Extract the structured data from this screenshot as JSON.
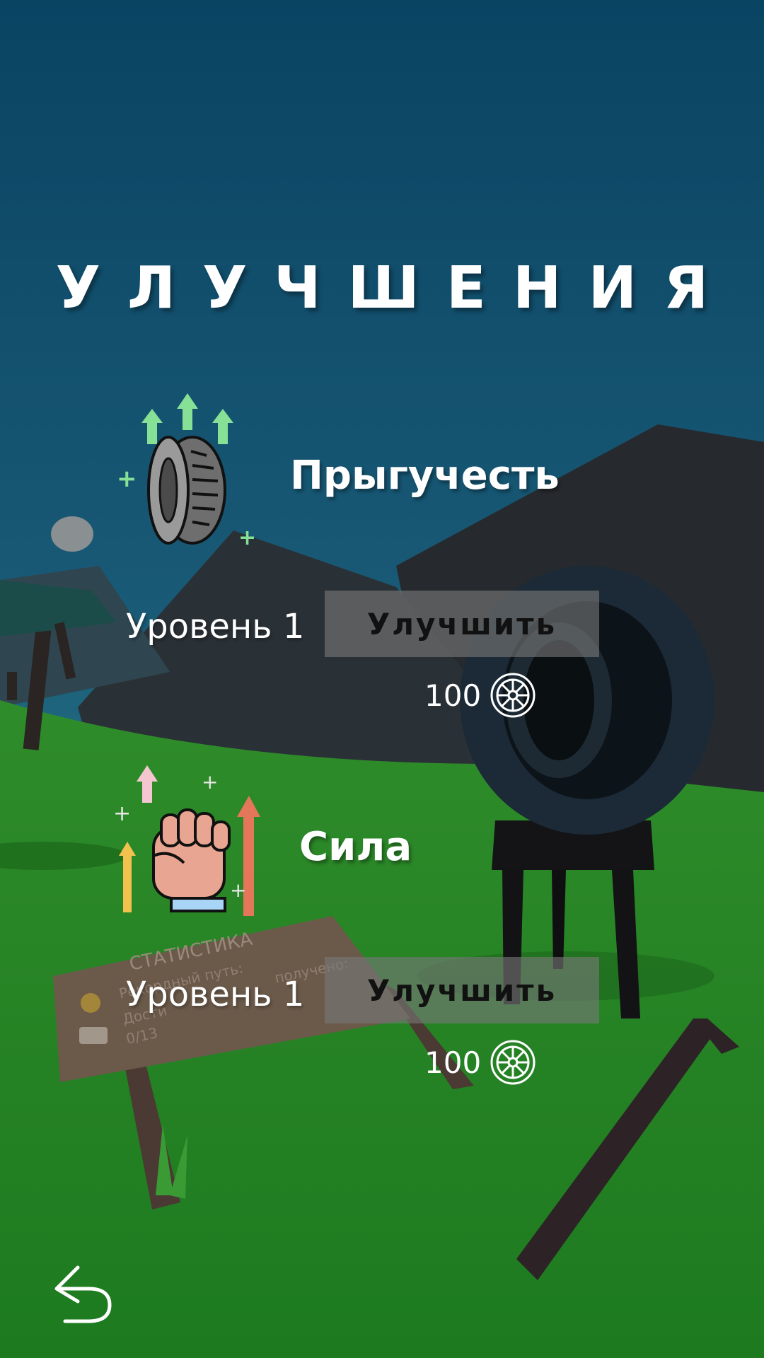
{
  "screen": {
    "title": "УЛУЧШЕНИЯ"
  },
  "upgrades": [
    {
      "name": "Прыгучесть",
      "icon": "bouncy-tire-icon",
      "level": "Уровень 1",
      "button_label": "Улучшить",
      "cost": "100",
      "cost_icon": "wheel-coin-icon"
    },
    {
      "name": "Сила",
      "icon": "fist-strength-icon",
      "level": "Уровень 1",
      "button_label": "Улучшить",
      "cost": "100",
      "cost_icon": "wheel-coin-icon"
    }
  ],
  "sign": {
    "title": "СТАТИСТИКА",
    "line1": "Рекордный путь:",
    "line2": "получено:",
    "line3": "Дости",
    "line4": "0/13"
  },
  "back": {
    "icon": "back-arrow-icon"
  },
  "colors": {
    "sky_top": "#0b4866",
    "sky_bottom": "#1f6a80",
    "grass": "#2f8a2a",
    "button": "#787878"
  }
}
